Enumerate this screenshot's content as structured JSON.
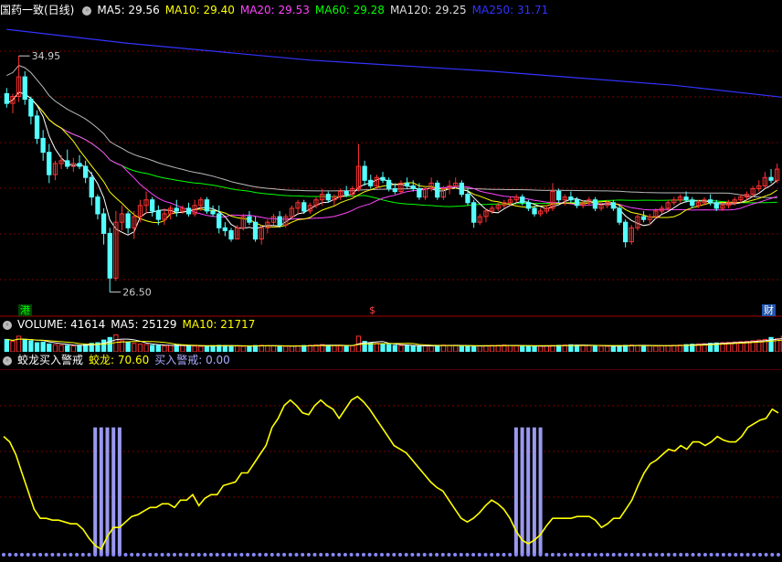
{
  "header": {
    "title": "国药一致(日线)",
    "ma": [
      {
        "label": "MA5: 29.56",
        "color": "#ffffff"
      },
      {
        "label": "MA10: 29.40",
        "color": "#ffff00"
      },
      {
        "label": "MA20: 29.53",
        "color": "#ff44ff"
      },
      {
        "label": "MA60: 29.28",
        "color": "#00ff00"
      },
      {
        "label": "MA120: 29.25",
        "color": "#dddddd"
      },
      {
        "label": "MA250: 31.71",
        "color": "#3333ff"
      }
    ]
  },
  "volume_header": {
    "label": "VOLUME: 41614",
    "ma5": "MA5: 25129",
    "ma10": "MA10: 21717"
  },
  "indicator_header": {
    "name": "蛟龙买入警戒",
    "jiaolong": "蛟龙: 70.60",
    "alert": "买入警戒: 0.00"
  },
  "badges": {
    "left": "港",
    "mid": "$",
    "right": "财"
  },
  "chart_data": [
    {
      "type": "candlestick",
      "high_label": "34.95",
      "low_label": "26.50",
      "ylim": [
        25.9,
        36.1
      ],
      "candles": [
        [
          33.6,
          33.8,
          33.1,
          33.25
        ],
        [
          33.25,
          33.6,
          32.9,
          33.5
        ],
        [
          33.5,
          34.95,
          33.3,
          34.2
        ],
        [
          34.2,
          34.4,
          33.2,
          33.4
        ],
        [
          33.4,
          33.5,
          32.5,
          32.8
        ],
        [
          32.8,
          33.0,
          31.8,
          32.0
        ],
        [
          32.0,
          32.3,
          31.2,
          31.5
        ],
        [
          31.5,
          31.8,
          30.4,
          30.7
        ],
        [
          30.7,
          31.2,
          30.5,
          31.1
        ],
        [
          31.1,
          31.4,
          30.9,
          31.2
        ],
        [
          31.2,
          31.6,
          30.9,
          31.0
        ],
        [
          31.0,
          31.3,
          30.8,
          31.1
        ],
        [
          31.1,
          31.4,
          30.9,
          31.0
        ],
        [
          31.0,
          31.2,
          30.4,
          30.6
        ],
        [
          30.6,
          30.8,
          29.6,
          29.9
        ],
        [
          29.9,
          30.0,
          29.1,
          29.3
        ],
        [
          29.3,
          29.5,
          28.2,
          28.6
        ],
        [
          28.6,
          28.8,
          26.5,
          27.0
        ],
        [
          27.0,
          29.4,
          26.9,
          29.0
        ],
        [
          29.0,
          29.6,
          28.7,
          29.3
        ],
        [
          29.3,
          29.4,
          28.6,
          28.8
        ],
        [
          28.8,
          29.4,
          28.4,
          29.2
        ],
        [
          29.2,
          29.8,
          29.0,
          29.6
        ],
        [
          29.6,
          30.1,
          29.3,
          29.8
        ],
        [
          29.8,
          29.9,
          29.2,
          29.4
        ],
        [
          29.4,
          29.6,
          28.9,
          29.1
        ],
        [
          29.1,
          29.5,
          28.9,
          29.3
        ],
        [
          29.3,
          29.6,
          29.1,
          29.5
        ],
        [
          29.5,
          29.8,
          29.2,
          29.4
        ],
        [
          29.4,
          29.6,
          29.3,
          29.5
        ],
        [
          29.5,
          29.7,
          29.2,
          29.3
        ],
        [
          29.3,
          29.8,
          29.2,
          29.6
        ],
        [
          29.6,
          29.9,
          29.4,
          29.8
        ],
        [
          29.8,
          29.9,
          29.3,
          29.4
        ],
        [
          29.4,
          29.6,
          29.2,
          29.3
        ],
        [
          29.3,
          29.6,
          28.6,
          28.8
        ],
        [
          28.8,
          29.0,
          28.5,
          28.7
        ],
        [
          28.7,
          28.8,
          28.3,
          28.4
        ],
        [
          28.4,
          28.9,
          28.4,
          28.8
        ],
        [
          28.8,
          29.3,
          28.7,
          29.2
        ],
        [
          29.2,
          29.4,
          28.9,
          29.0
        ],
        [
          29.0,
          29.2,
          28.3,
          28.4
        ],
        [
          28.4,
          28.9,
          28.2,
          28.8
        ],
        [
          28.8,
          29.1,
          28.6,
          29.0
        ],
        [
          29.0,
          29.3,
          28.9,
          29.2
        ],
        [
          29.2,
          29.4,
          28.8,
          28.9
        ],
        [
          28.9,
          29.3,
          28.8,
          29.2
        ],
        [
          29.2,
          29.6,
          29.1,
          29.5
        ],
        [
          29.5,
          29.8,
          29.3,
          29.7
        ],
        [
          29.7,
          29.8,
          29.3,
          29.4
        ],
        [
          29.4,
          29.7,
          29.3,
          29.6
        ],
        [
          29.6,
          29.9,
          29.5,
          29.8
        ],
        [
          29.8,
          30.2,
          29.6,
          30.0
        ],
        [
          30.0,
          30.1,
          29.7,
          29.8
        ],
        [
          29.8,
          30.0,
          29.6,
          29.9
        ],
        [
          29.9,
          30.2,
          29.8,
          30.1
        ],
        [
          30.1,
          30.3,
          29.9,
          30.0
        ],
        [
          30.0,
          30.3,
          29.9,
          30.2
        ],
        [
          30.2,
          31.8,
          30.1,
          31.0
        ],
        [
          31.0,
          31.2,
          30.3,
          30.5
        ],
        [
          30.5,
          30.7,
          30.2,
          30.3
        ],
        [
          30.3,
          30.7,
          30.2,
          30.6
        ],
        [
          30.6,
          30.8,
          30.4,
          30.5
        ],
        [
          30.5,
          30.6,
          30.1,
          30.2
        ],
        [
          30.2,
          30.4,
          30.0,
          30.1
        ],
        [
          30.1,
          30.5,
          30.0,
          30.4
        ],
        [
          30.4,
          30.6,
          30.2,
          30.3
        ],
        [
          30.3,
          30.5,
          30.1,
          30.2
        ],
        [
          30.2,
          30.4,
          29.8,
          29.9
        ],
        [
          29.9,
          30.3,
          29.8,
          30.2
        ],
        [
          30.2,
          30.6,
          30.1,
          30.4
        ],
        [
          30.4,
          30.5,
          29.8,
          29.9
        ],
        [
          29.9,
          30.3,
          29.8,
          30.2
        ],
        [
          30.2,
          30.5,
          30.0,
          30.3
        ],
        [
          30.3,
          30.6,
          30.2,
          30.4
        ],
        [
          30.4,
          30.5,
          29.9,
          30.0
        ],
        [
          30.0,
          30.2,
          29.6,
          29.7
        ],
        [
          29.7,
          29.8,
          28.8,
          29.0
        ],
        [
          29.0,
          29.3,
          28.9,
          29.2
        ],
        [
          29.2,
          29.5,
          29.0,
          29.4
        ],
        [
          29.4,
          29.6,
          29.3,
          29.5
        ],
        [
          29.5,
          29.7,
          29.4,
          29.6
        ],
        [
          29.6,
          29.8,
          29.5,
          29.7
        ],
        [
          29.7,
          29.9,
          29.6,
          29.8
        ],
        [
          29.8,
          30.0,
          29.7,
          29.9
        ],
        [
          29.9,
          30.0,
          29.6,
          29.7
        ],
        [
          29.7,
          29.8,
          29.4,
          29.5
        ],
        [
          29.5,
          29.6,
          29.2,
          29.3
        ],
        [
          29.3,
          29.5,
          29.2,
          29.4
        ],
        [
          29.4,
          29.6,
          29.3,
          29.5
        ],
        [
          29.5,
          30.4,
          29.4,
          30.1
        ],
        [
          30.1,
          30.2,
          29.7,
          29.8
        ],
        [
          29.8,
          30.0,
          29.6,
          29.9
        ],
        [
          29.9,
          30.1,
          29.7,
          29.8
        ],
        [
          29.8,
          29.9,
          29.5,
          29.6
        ],
        [
          29.6,
          29.8,
          29.5,
          29.7
        ],
        [
          29.7,
          29.9,
          29.6,
          29.8
        ],
        [
          29.8,
          29.9,
          29.4,
          29.5
        ],
        [
          29.5,
          29.7,
          29.4,
          29.6
        ],
        [
          29.6,
          29.8,
          29.5,
          29.7
        ],
        [
          29.7,
          29.8,
          29.4,
          29.5
        ],
        [
          29.5,
          29.6,
          28.9,
          29.0
        ],
        [
          29.0,
          29.1,
          28.1,
          28.3
        ],
        [
          28.3,
          28.9,
          28.2,
          28.8
        ],
        [
          28.8,
          29.3,
          28.7,
          29.2
        ],
        [
          29.2,
          29.4,
          29.0,
          29.1
        ],
        [
          29.1,
          29.3,
          28.9,
          29.2
        ],
        [
          29.2,
          29.5,
          29.1,
          29.4
        ],
        [
          29.4,
          29.6,
          29.3,
          29.5
        ],
        [
          29.5,
          29.8,
          29.4,
          29.7
        ],
        [
          29.7,
          29.9,
          29.6,
          29.8
        ],
        [
          29.8,
          30.0,
          29.7,
          29.9
        ],
        [
          29.9,
          30.1,
          29.7,
          29.8
        ],
        [
          29.8,
          29.9,
          29.5,
          29.6
        ],
        [
          29.6,
          29.8,
          29.5,
          29.7
        ],
        [
          29.7,
          29.9,
          29.6,
          29.8
        ],
        [
          29.8,
          30.0,
          29.6,
          29.7
        ],
        [
          29.7,
          29.8,
          29.4,
          29.5
        ],
        [
          29.5,
          29.7,
          29.4,
          29.6
        ],
        [
          29.6,
          29.8,
          29.5,
          29.7
        ],
        [
          29.7,
          29.9,
          29.6,
          29.8
        ],
        [
          29.8,
          30.0,
          29.7,
          29.9
        ],
        [
          29.9,
          30.1,
          29.8,
          30.0
        ],
        [
          30.0,
          30.3,
          29.9,
          30.2
        ],
        [
          30.2,
          30.5,
          30.1,
          30.3
        ],
        [
          30.3,
          30.8,
          30.2,
          30.6
        ],
        [
          30.6,
          30.9,
          30.4,
          30.5
        ],
        [
          30.5,
          31.1,
          30.4,
          30.9
        ]
      ],
      "ma250": [
        [
          0,
          35.9
        ],
        [
          20,
          35.4
        ],
        [
          50,
          34.8
        ],
        [
          80,
          34.4
        ],
        [
          110,
          33.9
        ],
        [
          135,
          33.3
        ]
      ]
    },
    {
      "type": "bar",
      "title": "VOLUME",
      "values": [
        95,
        80,
        120,
        90,
        85,
        70,
        75,
        60,
        55,
        50,
        48,
        45,
        50,
        55,
        65,
        70,
        90,
        110,
        130,
        85,
        70,
        65,
        60,
        55,
        50,
        48,
        45,
        50,
        52,
        48,
        46,
        44,
        42,
        45,
        47,
        50,
        48,
        46,
        44,
        42,
        45,
        48,
        50,
        47,
        45,
        43,
        42,
        44,
        46,
        48,
        50,
        52,
        55,
        50,
        48,
        46,
        45,
        47,
        120,
        80,
        70,
        65,
        60,
        55,
        50,
        48,
        46,
        45,
        44,
        46,
        48,
        50,
        52,
        50,
        48,
        46,
        44,
        42,
        45,
        47,
        48,
        50,
        52,
        49,
        47,
        45,
        43,
        42,
        44,
        46,
        48,
        50,
        52,
        54,
        52,
        50,
        48,
        46,
        44,
        42,
        45,
        47,
        50,
        52,
        50,
        48,
        46,
        44,
        46,
        48,
        50,
        52,
        55,
        58,
        60,
        62,
        65,
        68,
        70,
        72,
        75,
        78,
        80,
        85,
        90,
        95,
        110,
        100,
        120
      ],
      "ylim": [
        0,
        140
      ]
    },
    {
      "type": "line",
      "title": "蛟龙买入警戒",
      "series": [
        {
          "name": "蛟龙",
          "values": [
            65,
            62,
            55,
            45,
            35,
            25,
            20,
            20,
            19,
            19,
            18,
            17,
            17,
            14,
            9,
            5,
            3,
            10,
            15,
            15,
            18,
            21,
            22,
            24,
            26,
            26,
            28,
            28,
            26,
            30,
            30,
            33,
            27,
            31,
            33,
            33,
            38,
            39,
            40,
            45,
            45,
            50,
            55,
            60,
            70,
            75,
            82,
            85,
            82,
            78,
            77,
            82,
            85,
            82,
            80,
            75,
            80,
            85,
            87,
            84,
            80,
            75,
            70,
            65,
            60,
            58,
            56,
            52,
            48,
            44,
            40,
            37,
            35,
            30,
            25,
            20,
            18,
            20,
            23,
            27,
            30,
            28,
            25,
            20,
            13,
            8,
            6,
            8,
            11,
            16,
            20,
            20,
            20,
            20,
            21,
            21,
            21,
            19,
            15,
            17,
            20,
            20,
            25,
            30,
            38,
            45,
            50,
            52,
            55,
            58,
            57,
            60,
            58,
            62,
            62,
            60,
            62,
            65,
            63,
            62,
            62,
            65,
            70,
            72,
            74,
            75,
            80,
            78
          ]
        },
        {
          "name": "买入警戒",
          "values": [
            0,
            0,
            0,
            0,
            0,
            0,
            0,
            0,
            0,
            0,
            0,
            0,
            0,
            0,
            0,
            100,
            100,
            100,
            100,
            100,
            0,
            0,
            0,
            0,
            0,
            0,
            0,
            0,
            0,
            0,
            0,
            0,
            0,
            0,
            0,
            0,
            0,
            0,
            0,
            0,
            0,
            0,
            0,
            0,
            0,
            0,
            0,
            0,
            0,
            0,
            0,
            0,
            0,
            0,
            0,
            0,
            0,
            0,
            0,
            0,
            0,
            0,
            0,
            0,
            0,
            0,
            0,
            0,
            0,
            0,
            0,
            0,
            0,
            0,
            0,
            0,
            0,
            0,
            0,
            0,
            0,
            0,
            0,
            0,
            100,
            100,
            100,
            100,
            100,
            0,
            0,
            0,
            0,
            0,
            0,
            0,
            0,
            0,
            0,
            0,
            0,
            0,
            0,
            0,
            0,
            0,
            0,
            0,
            0,
            0,
            0,
            0,
            0,
            0,
            0,
            0,
            0,
            0,
            0,
            0,
            0,
            0,
            0,
            0,
            0,
            0,
            0,
            0,
            0,
            0,
            0,
            0
          ]
        }
      ],
      "ylim": [
        0,
        100
      ]
    }
  ]
}
